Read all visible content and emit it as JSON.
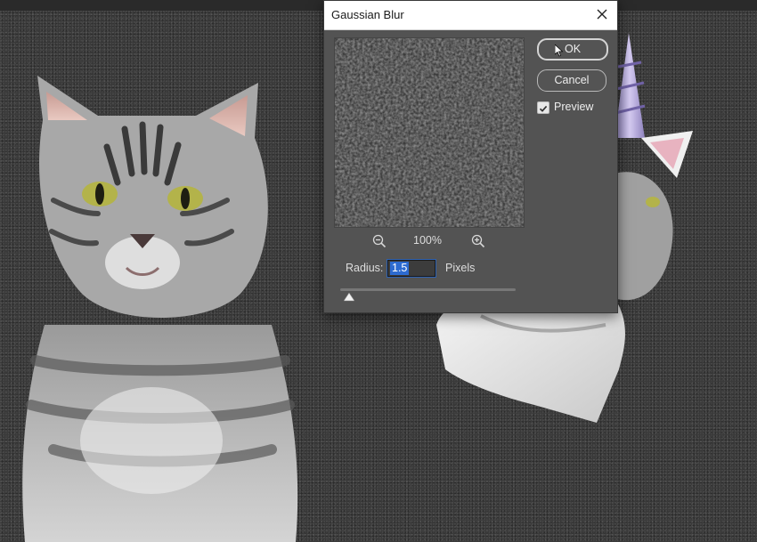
{
  "dialog": {
    "title": "Gaussian Blur",
    "close_icon": "close-icon",
    "ok_label": "OK",
    "cancel_label": "Cancel",
    "preview_label": "Preview",
    "preview_checked": true,
    "zoom_out_icon": "zoom-out-icon",
    "zoom_in_icon": "zoom-in-icon",
    "zoom_level": "100%",
    "radius_label": "Radius:",
    "radius_value": "1.5",
    "radius_units": "Pixels",
    "radius_slider_fraction": 0.05
  },
  "canvas": {
    "content": [
      "tabby-cat-photo",
      "unicorn-costume-cat-photo"
    ]
  },
  "colors": {
    "dialog_bg": "#535353",
    "titlebar_bg": "#ffffff",
    "selection": "#2d6bd0",
    "canvas_noise": "#3a3a3a"
  }
}
